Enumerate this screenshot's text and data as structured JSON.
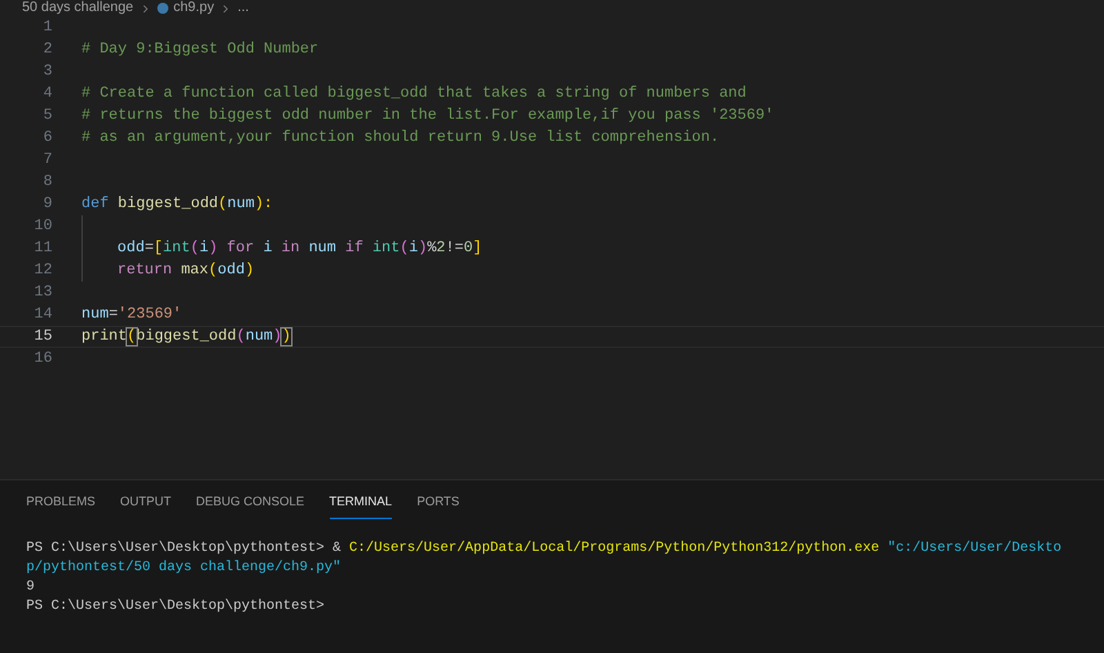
{
  "breadcrumb": [
    {
      "label": "50 days challenge",
      "kind": "folder"
    },
    {
      "label": "ch9.py",
      "kind": "file"
    },
    {
      "label": "...",
      "kind": "more"
    }
  ],
  "editor": {
    "lines": [
      {
        "number": "1",
        "current": false
      },
      {
        "number": "2",
        "current": false,
        "tokens": [
          {
            "text": "# Day 9:Biggest Odd Number",
            "kind": "comment"
          }
        ]
      },
      {
        "number": "3",
        "current": false
      },
      {
        "number": "4",
        "current": false,
        "tokens": [
          {
            "text": "# Create a function called biggest_odd that takes a string of numbers and",
            "kind": "comment"
          }
        ]
      },
      {
        "number": "5",
        "current": false,
        "tokens": [
          {
            "text": "# returns the biggest odd number in the list.For example,if you pass '23569'",
            "kind": "comment"
          }
        ]
      },
      {
        "number": "6",
        "current": false,
        "tokens": [
          {
            "text": "# as an argument,your function should return 9.Use list comprehension.",
            "kind": "comment"
          }
        ]
      },
      {
        "number": "7",
        "current": false
      },
      {
        "number": "8",
        "current": false
      },
      {
        "number": "9",
        "current": false,
        "tokens": [
          {
            "text": "def",
            "kind": "keyword"
          },
          {
            "text": " biggest_odd",
            "kind": "function"
          },
          {
            "text": "(",
            "kind": "paren"
          },
          {
            "text": "num",
            "kind": "variable"
          },
          {
            "text": "):",
            "kind": "paren"
          }
        ]
      },
      {
        "number": "10",
        "current": false,
        "indented": true
      },
      {
        "number": "11",
        "current": false,
        "indented": true,
        "tokens": [
          {
            "text": "odd",
            "kind": "variable"
          },
          {
            "text": "=",
            "kind": "plain"
          },
          {
            "text": "[",
            "kind": "paren"
          },
          {
            "text": "int",
            "kind": "builtin"
          },
          {
            "text": "(",
            "kind": "bracket2"
          },
          {
            "text": "i",
            "kind": "variable"
          },
          {
            "text": ")",
            "kind": "bracket2"
          },
          {
            "text": " for ",
            "kind": "control"
          },
          {
            "text": "i",
            "kind": "variable"
          },
          {
            "text": " in ",
            "kind": "control"
          },
          {
            "text": "num",
            "kind": "variable"
          },
          {
            "text": " if ",
            "kind": "control"
          },
          {
            "text": "int",
            "kind": "builtin"
          },
          {
            "text": "(",
            "kind": "bracket2"
          },
          {
            "text": "i",
            "kind": "variable"
          },
          {
            "text": ")",
            "kind": "bracket2"
          },
          {
            "text": "%",
            "kind": "plain"
          },
          {
            "text": "2",
            "kind": "number"
          },
          {
            "text": "!=",
            "kind": "plain"
          },
          {
            "text": "0",
            "kind": "number"
          },
          {
            "text": "]",
            "kind": "paren"
          }
        ]
      },
      {
        "number": "12",
        "current": false,
        "indented": true,
        "tokens": [
          {
            "text": "return",
            "kind": "control"
          },
          {
            "text": " max",
            "kind": "function"
          },
          {
            "text": "(",
            "kind": "paren"
          },
          {
            "text": "odd",
            "kind": "variable"
          },
          {
            "text": ")",
            "kind": "paren"
          }
        ]
      },
      {
        "number": "13",
        "current": false
      },
      {
        "number": "14",
        "current": false,
        "tokens": [
          {
            "text": "num",
            "kind": "variable"
          },
          {
            "text": "=",
            "kind": "plain"
          },
          {
            "text": "'23569'",
            "kind": "string"
          }
        ]
      },
      {
        "number": "15",
        "current": true,
        "tokens": [
          {
            "text": "print",
            "kind": "function"
          },
          {
            "text": "(",
            "kind": "matched"
          },
          {
            "text": "biggest_odd",
            "kind": "function"
          },
          {
            "text": "(",
            "kind": "bracket2"
          },
          {
            "text": "num",
            "kind": "variable"
          },
          {
            "text": ")",
            "kind": "bracket2"
          },
          {
            "text": ")",
            "kind": "matched"
          }
        ]
      },
      {
        "number": "16",
        "current": false
      }
    ]
  },
  "panel": {
    "tabs": [
      {
        "label": "PROBLEMS",
        "selected": false
      },
      {
        "label": "OUTPUT",
        "selected": false
      },
      {
        "label": "DEBUG CONSOLE",
        "selected": false
      },
      {
        "label": "TERMINAL",
        "selected": true
      },
      {
        "label": "PORTS",
        "selected": false
      }
    ],
    "terminal": [
      [
        {
          "text": "PS C:\\Users\\User\\Desktop\\pythontest> & ",
          "kind": "plain"
        },
        {
          "text": "C:/Users/User/AppData/Local/Programs/Python/Python312/python.exe",
          "kind": "command"
        },
        {
          "text": " \"c:/Users/User/Deskto",
          "kind": "argument"
        }
      ],
      [
        {
          "text": "p/pythontest/50 days challenge/ch9.py\"",
          "kind": "argument"
        }
      ],
      [
        {
          "text": "9",
          "kind": "plain"
        }
      ],
      [
        {
          "text": "PS C:\\Users\\User\\Desktop\\pythontest>",
          "kind": "plain"
        }
      ]
    ]
  }
}
